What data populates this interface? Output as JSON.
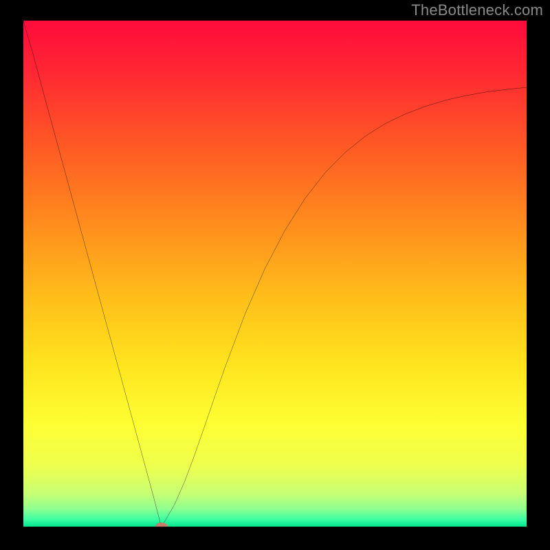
{
  "watermark": "TheBottleneck.com",
  "chart_data": {
    "type": "line",
    "title": "",
    "xlabel": "",
    "ylabel": "",
    "xlim": [
      0,
      100
    ],
    "ylim": [
      0,
      100
    ],
    "background_gradient_stops": [
      {
        "offset": 0.0,
        "color": "#ff0b3b"
      },
      {
        "offset": 0.1,
        "color": "#ff2733"
      },
      {
        "offset": 0.25,
        "color": "#ff5a24"
      },
      {
        "offset": 0.4,
        "color": "#ff8c1d"
      },
      {
        "offset": 0.55,
        "color": "#ffbf1a"
      },
      {
        "offset": 0.68,
        "color": "#ffe41e"
      },
      {
        "offset": 0.8,
        "color": "#fdff33"
      },
      {
        "offset": 0.88,
        "color": "#efff4e"
      },
      {
        "offset": 0.935,
        "color": "#c7ff74"
      },
      {
        "offset": 0.965,
        "color": "#8fff90"
      },
      {
        "offset": 0.985,
        "color": "#40ffa4"
      },
      {
        "offset": 1.0,
        "color": "#00e58f"
      }
    ],
    "series": [
      {
        "name": "curve",
        "color": "#000000",
        "x": [
          0,
          2,
          4,
          6,
          8,
          10,
          12,
          14,
          16,
          18,
          20,
          22,
          24,
          26,
          27.4,
          28,
          30,
          32,
          34,
          36,
          38,
          40,
          44,
          48,
          52,
          56,
          60,
          64,
          68,
          72,
          76,
          80,
          84,
          88,
          92,
          96,
          100
        ],
        "y": [
          100,
          93.1,
          85.7,
          78.4,
          71.1,
          63.8,
          56.5,
          49.2,
          41.9,
          34.6,
          27.3,
          20.0,
          12.7,
          5.4,
          0,
          0.9,
          4.3,
          8.8,
          14.1,
          19.8,
          25.6,
          31.3,
          41.9,
          51.0,
          58.6,
          64.9,
          70.0,
          74.0,
          77.2,
          79.7,
          81.6,
          83.1,
          84.3,
          85.2,
          85.9,
          86.4,
          86.8
        ]
      }
    ],
    "marker": {
      "x": 27.4,
      "y": 0,
      "color": "#c97a68",
      "rx": 1.25,
      "ry": 0.8
    }
  }
}
